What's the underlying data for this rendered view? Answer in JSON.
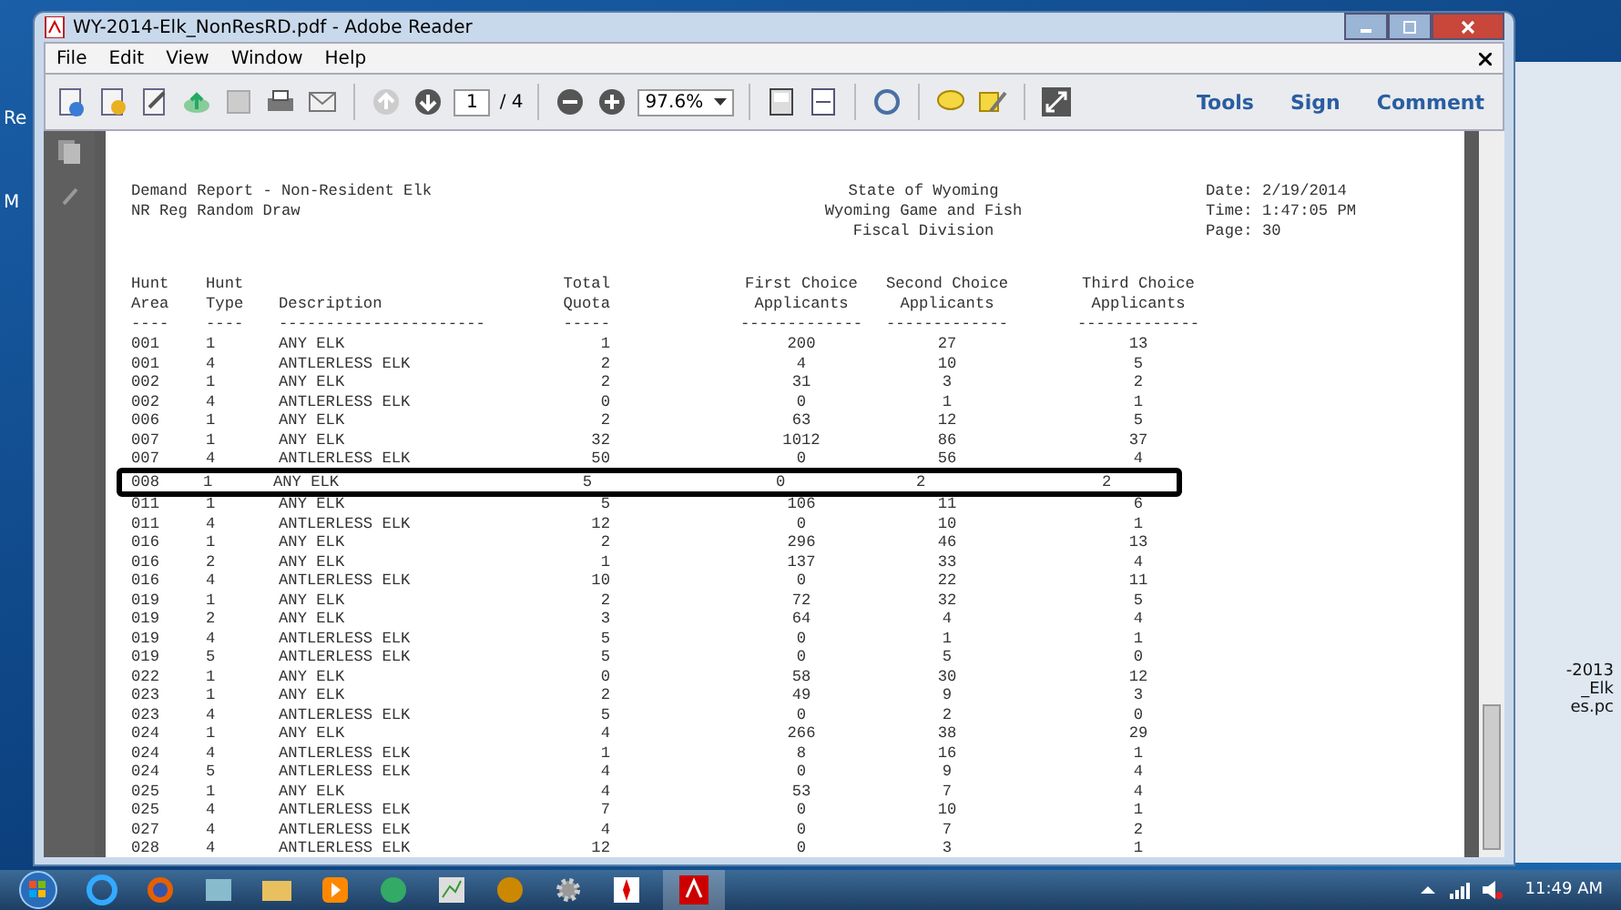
{
  "desktop": {
    "labels": [
      "Re",
      "M"
    ]
  },
  "window": {
    "title": "WY-2014-Elk_NonResRD.pdf - Adobe Reader"
  },
  "menu": [
    "File",
    "Edit",
    "View",
    "Window",
    "Help"
  ],
  "toolbar": {
    "page": "1",
    "page_total": "/ 4",
    "zoom": "97.6%",
    "links": [
      "Tools",
      "Sign",
      "Comment"
    ]
  },
  "report": {
    "left": [
      "Demand Report - Non-Resident Elk",
      "NR Reg Random Draw"
    ],
    "center": [
      "State of Wyoming",
      "Wyoming Game and Fish",
      "Fiscal Division"
    ],
    "right": [
      "Date: 2/19/2014",
      "Time: 1:47:05 PM",
      "Page: 30"
    ]
  },
  "table": {
    "columns": [
      {
        "lines": [
          "Hunt",
          "Area"
        ],
        "rule": "----"
      },
      {
        "lines": [
          "Hunt",
          "Type"
        ],
        "rule": "----"
      },
      {
        "lines": [
          "Description"
        ],
        "rule": "----------------------"
      },
      {
        "lines": [
          "Total",
          "Quota"
        ],
        "rule": "-----"
      },
      {
        "lines": [
          "First Choice",
          "Applicants"
        ],
        "rule": "-------------"
      },
      {
        "lines": [
          "Second Choice",
          "Applicants"
        ],
        "rule": "-------------"
      },
      {
        "lines": [
          "Third Choice",
          "Applicants"
        ],
        "rule": "-------------"
      }
    ],
    "rows": [
      {
        "cells": [
          "001",
          "1",
          "ANY ELK",
          "1",
          "200",
          "27",
          "13"
        ],
        "highlighted": false
      },
      {
        "cells": [
          "001",
          "4",
          "ANTLERLESS ELK",
          "2",
          "4",
          "10",
          "5"
        ],
        "highlighted": false
      },
      {
        "cells": [
          "002",
          "1",
          "ANY ELK",
          "2",
          "31",
          "3",
          "2"
        ],
        "highlighted": false
      },
      {
        "cells": [
          "002",
          "4",
          "ANTLERLESS ELK",
          "0",
          "0",
          "1",
          "1"
        ],
        "highlighted": false
      },
      {
        "cells": [
          "006",
          "1",
          "ANY ELK",
          "2",
          "63",
          "12",
          "5"
        ],
        "highlighted": false
      },
      {
        "cells": [
          "007",
          "1",
          "ANY ELK",
          "32",
          "1012",
          "86",
          "37"
        ],
        "highlighted": false
      },
      {
        "cells": [
          "007",
          "4",
          "ANTLERLESS ELK",
          "50",
          "0",
          "56",
          "4"
        ],
        "highlighted": false
      },
      {
        "cells": [
          "008",
          "1",
          "ANY ELK",
          "5",
          "0",
          "2",
          "2"
        ],
        "highlighted": true
      },
      {
        "cells": [
          "011",
          "1",
          "ANY ELK",
          "5",
          "106",
          "11",
          "6"
        ],
        "highlighted": false
      },
      {
        "cells": [
          "011",
          "4",
          "ANTLERLESS ELK",
          "12",
          "0",
          "10",
          "1"
        ],
        "highlighted": false
      },
      {
        "cells": [
          "016",
          "1",
          "ANY ELK",
          "2",
          "296",
          "46",
          "13"
        ],
        "highlighted": false
      },
      {
        "cells": [
          "016",
          "2",
          "ANY ELK",
          "1",
          "137",
          "33",
          "4"
        ],
        "highlighted": false
      },
      {
        "cells": [
          "016",
          "4",
          "ANTLERLESS ELK",
          "10",
          "0",
          "22",
          "11"
        ],
        "highlighted": false
      },
      {
        "cells": [
          "019",
          "1",
          "ANY ELK",
          "2",
          "72",
          "32",
          "5"
        ],
        "highlighted": false
      },
      {
        "cells": [
          "019",
          "2",
          "ANY ELK",
          "3",
          "64",
          "4",
          "4"
        ],
        "highlighted": false
      },
      {
        "cells": [
          "019",
          "4",
          "ANTLERLESS ELK",
          "5",
          "0",
          "1",
          "1"
        ],
        "highlighted": false
      },
      {
        "cells": [
          "019",
          "5",
          "ANTLERLESS ELK",
          "5",
          "0",
          "5",
          "0"
        ],
        "highlighted": false
      },
      {
        "cells": [
          "022",
          "1",
          "ANY ELK",
          "0",
          "58",
          "30",
          "12"
        ],
        "highlighted": false
      },
      {
        "cells": [
          "023",
          "1",
          "ANY ELK",
          "2",
          "49",
          "9",
          "3"
        ],
        "highlighted": false
      },
      {
        "cells": [
          "023",
          "4",
          "ANTLERLESS ELK",
          "5",
          "0",
          "2",
          "0"
        ],
        "highlighted": false
      },
      {
        "cells": [
          "024",
          "1",
          "ANY ELK",
          "4",
          "266",
          "38",
          "29"
        ],
        "highlighted": false
      },
      {
        "cells": [
          "024",
          "4",
          "ANTLERLESS ELK",
          "1",
          "8",
          "16",
          "1"
        ],
        "highlighted": false
      },
      {
        "cells": [
          "024",
          "5",
          "ANTLERLESS ELK",
          "4",
          "0",
          "9",
          "4"
        ],
        "highlighted": false
      },
      {
        "cells": [
          "025",
          "1",
          "ANY ELK",
          "4",
          "53",
          "7",
          "4"
        ],
        "highlighted": false
      },
      {
        "cells": [
          "025",
          "4",
          "ANTLERLESS ELK",
          "7",
          "0",
          "10",
          "1"
        ],
        "highlighted": false
      },
      {
        "cells": [
          "027",
          "4",
          "ANTLERLESS ELK",
          "4",
          "0",
          "7",
          "2"
        ],
        "highlighted": false
      },
      {
        "cells": [
          "028",
          "4",
          "ANTLERLESS ELK",
          "12",
          "0",
          "3",
          "1"
        ],
        "highlighted": false
      }
    ]
  },
  "behind_window": {
    "labels": [
      "-2013",
      "_Elk",
      "es.pc"
    ]
  },
  "taskbar": {
    "clock": "11:49 AM"
  }
}
